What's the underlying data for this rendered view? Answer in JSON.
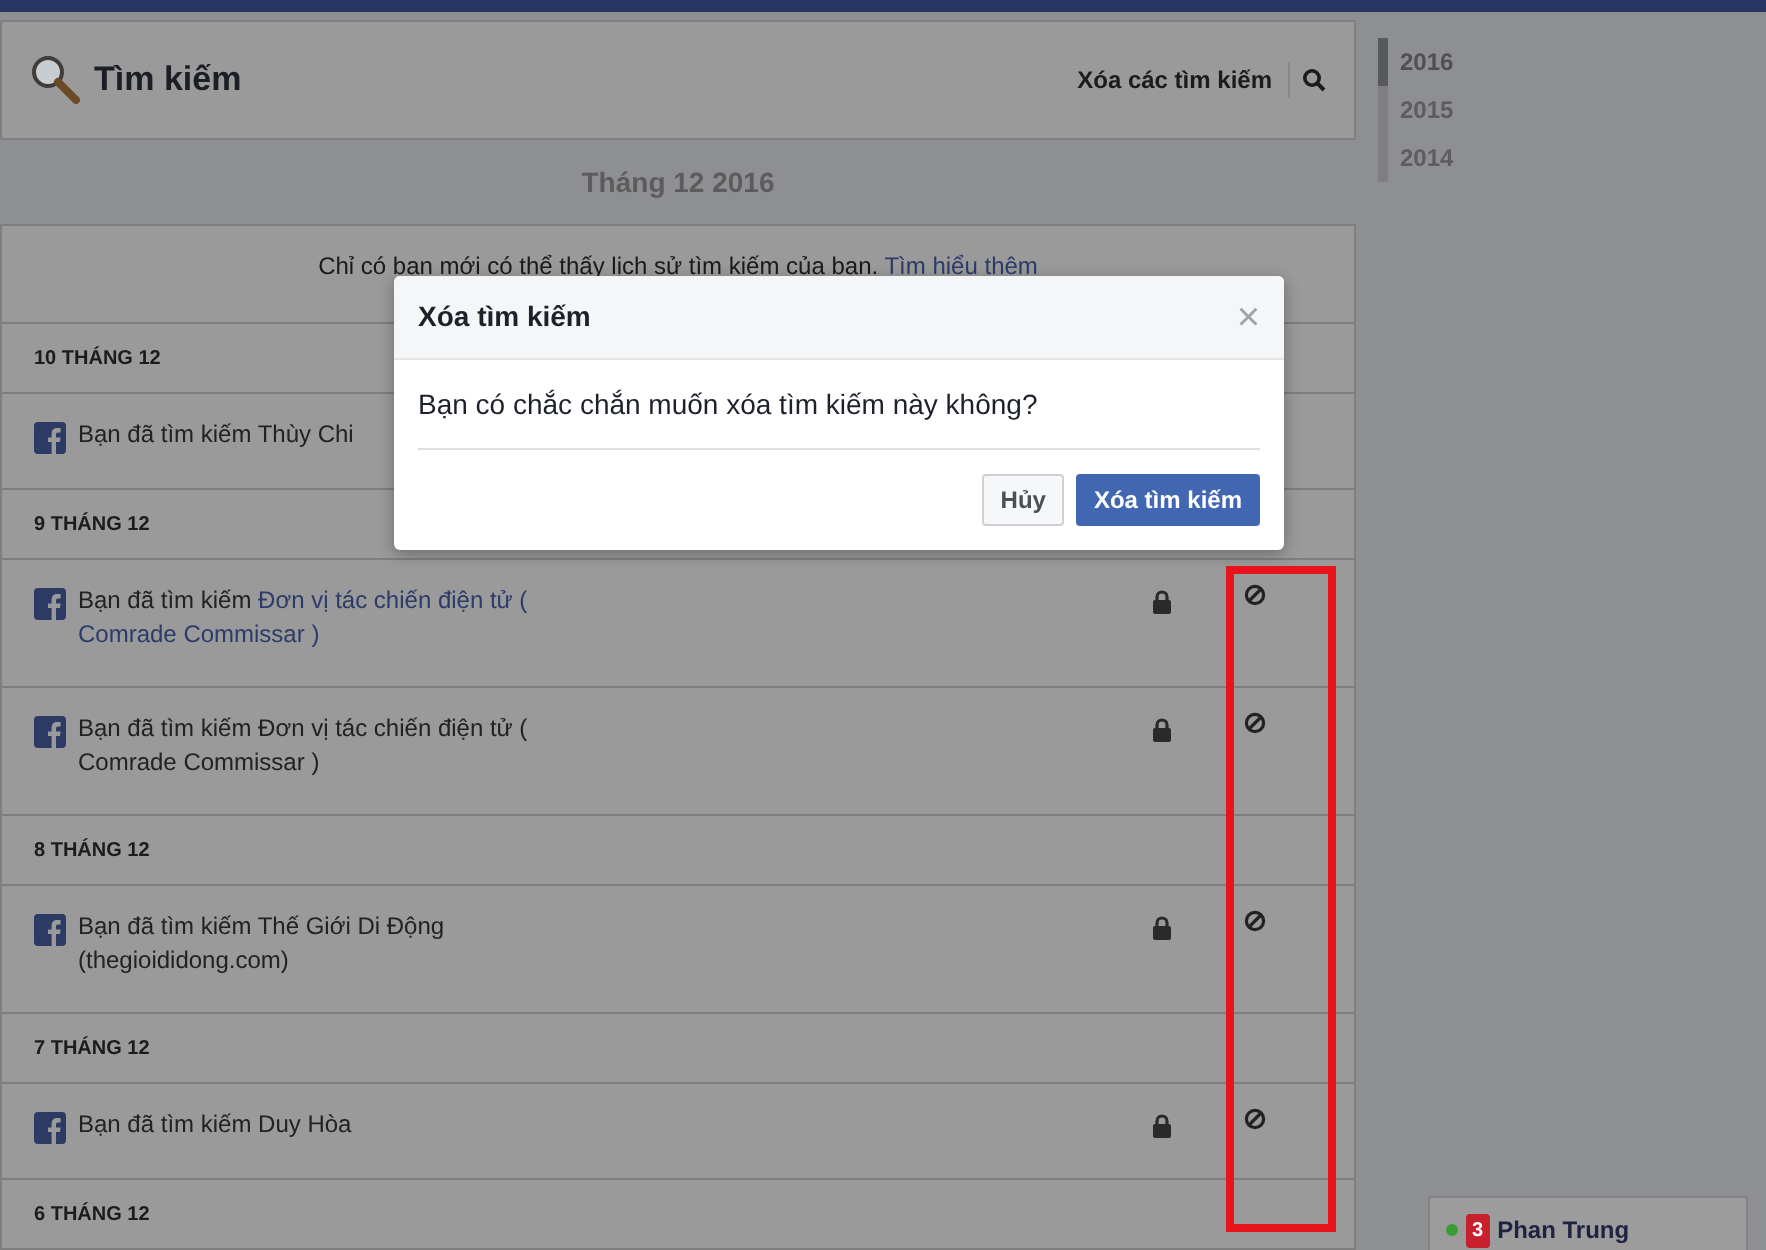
{
  "header": {
    "title": "Tìm kiếm",
    "clear_label": "Xóa các tìm kiếm"
  },
  "month_title": "Tháng 12 2016",
  "notice": {
    "text": "Chỉ có bạn mới có thể thấy lịch sử tìm kiếm của bạn.",
    "link": "Tìm hiểu thêm"
  },
  "groups": [
    {
      "date": "10 THÁNG 12",
      "entries": [
        {
          "prefix": "Bạn đã tìm kiếm",
          "query": "Thùy Chi",
          "linked": false
        }
      ]
    },
    {
      "date": "9 THÁNG 12",
      "entries": [
        {
          "prefix": "Bạn đã tìm kiếm",
          "query": "Đơn vị tác chiến điện tử ( Comrade Commissar )",
          "linked": true
        },
        {
          "prefix": "Bạn đã tìm kiếm",
          "query": "Đơn vị tác chiến điện tử ( Comrade Commissar )",
          "linked": false
        }
      ]
    },
    {
      "date": "8 THÁNG 12",
      "entries": [
        {
          "prefix": "Bạn đã tìm kiếm",
          "query": "Thế Giới Di Động (thegioididong.com)",
          "linked": false
        }
      ]
    },
    {
      "date": "7 THÁNG 12",
      "entries": [
        {
          "prefix": "Bạn đã tìm kiếm",
          "query": "Duy Hòa",
          "linked": false
        }
      ]
    },
    {
      "date": "6 THÁNG 12"
    }
  ],
  "years": [
    {
      "label": "2016",
      "selected": true
    },
    {
      "label": "2015",
      "selected": false
    },
    {
      "label": "2014",
      "selected": false
    }
  ],
  "dialog": {
    "title": "Xóa tìm kiếm",
    "close": "×",
    "message": "Bạn có chắc chắn muốn xóa tìm kiếm này không?",
    "cancel": "Hủy",
    "confirm": "Xóa tìm kiếm"
  },
  "chat": {
    "count": "3",
    "name": "Phan Trung",
    "online": true
  }
}
